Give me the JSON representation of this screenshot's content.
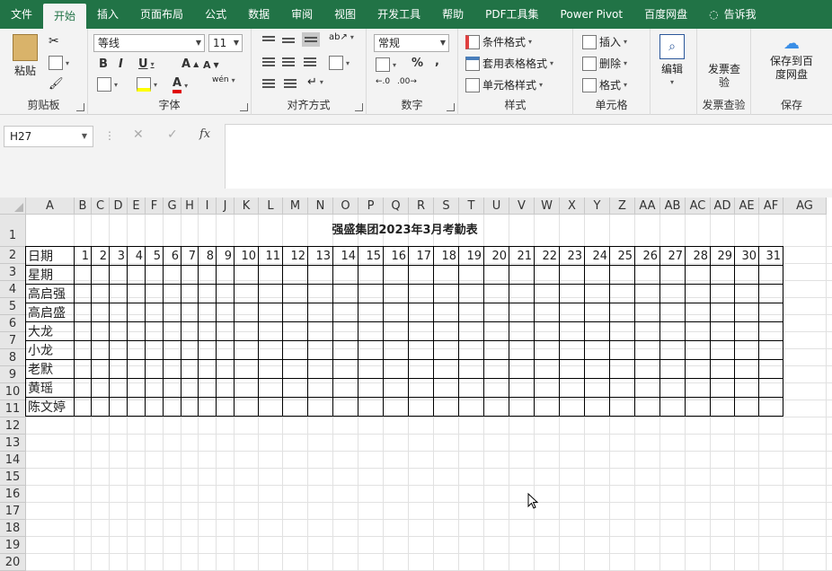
{
  "tabs": [
    "文件",
    "开始",
    "插入",
    "页面布局",
    "公式",
    "数据",
    "审阅",
    "视图",
    "开发工具",
    "帮助",
    "PDF工具集",
    "Power Pivot",
    "百度网盘"
  ],
  "active_tab": 1,
  "tell_me": "告诉我",
  "ribbon": {
    "clipboard": {
      "paste": "粘贴",
      "label": "剪贴板"
    },
    "font": {
      "name": "等线",
      "size": "11",
      "bold": "B",
      "italic": "I",
      "underline": "U",
      "grow": "A",
      "shrink": "A",
      "phonetic": "wén",
      "label": "字体"
    },
    "alignment": {
      "label": "对齐方式"
    },
    "number": {
      "format": "常规",
      "percent": "%",
      "comma": ",",
      "label": "数字"
    },
    "styles": {
      "conditional": "条件格式",
      "table": "套用表格格式",
      "cell": "单元格样式",
      "label": "样式"
    },
    "cells": {
      "insert": "插入",
      "delete": "删除",
      "format": "格式",
      "label": "单元格"
    },
    "editing": {
      "edit": "编辑"
    },
    "invoice": {
      "check": "发票查验",
      "label": "发票查验"
    },
    "save": {
      "save_to": "保存到百度网盘",
      "label": "保存"
    }
  },
  "formula_bar": {
    "name_box": "H27",
    "fx": "fx",
    "cancel": "✕",
    "enter": "✓",
    "value": ""
  },
  "columns": [
    "A",
    "B",
    "C",
    "D",
    "E",
    "F",
    "G",
    "H",
    "I",
    "J",
    "K",
    "L",
    "M",
    "N",
    "O",
    "P",
    "Q",
    "R",
    "S",
    "T",
    "U",
    "V",
    "W",
    "X",
    "Y",
    "Z",
    "AA",
    "AB",
    "AC",
    "AD",
    "AE",
    "AF",
    "AG"
  ],
  "rows": [
    "1",
    "2",
    "3",
    "4",
    "5",
    "6",
    "7",
    "8",
    "9",
    "10",
    "11",
    "12",
    "13",
    "14",
    "15",
    "16",
    "17",
    "18",
    "19",
    "20"
  ],
  "sheet": {
    "title": "强盛集团2023年3月考勤表",
    "header_label": "日期",
    "days": [
      "1",
      "2",
      "3",
      "4",
      "5",
      "6",
      "7",
      "8",
      "9",
      "10",
      "11",
      "12",
      "13",
      "14",
      "15",
      "16",
      "17",
      "18",
      "19",
      "20",
      "21",
      "22",
      "23",
      "24",
      "25",
      "26",
      "27",
      "28",
      "29",
      "30",
      "31"
    ],
    "row_labels": [
      "星期",
      "高启强",
      "高启盛",
      "大龙",
      "小龙",
      "老默",
      "黄瑶",
      "陈文婷"
    ]
  }
}
